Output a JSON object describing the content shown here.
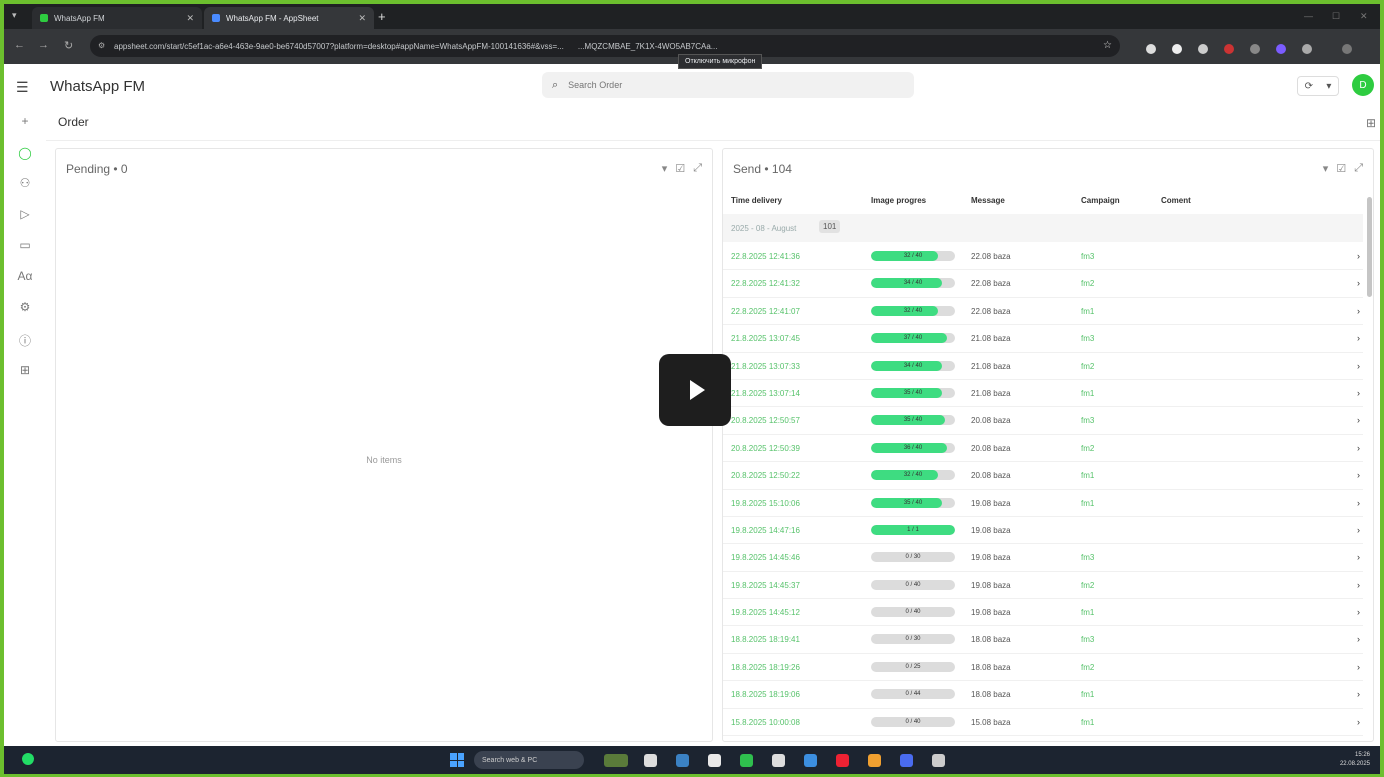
{
  "browser": {
    "tabs": [
      {
        "label": "WhatsApp FM",
        "active": false
      },
      {
        "label": "WhatsApp FM - AppSheet",
        "active": true
      }
    ],
    "url": "appsheet.com/start/c5ef1ac-a6e4-463e-9ae0-be6740d57007?platform=desktop#appName=WhatsAppFM-100141636#&vss=...",
    "url_tail": "...MQZCMBAE_7K1X-4WO5AB7CAa...",
    "tooltip": "Отключить микрофон"
  },
  "app": {
    "title": "WhatsApp FM",
    "search_placeholder": "Search Order",
    "avatar_initial": "D",
    "breadcrumb": "Order"
  },
  "pending_panel": {
    "title": "Pending • 0",
    "empty_text": "No items"
  },
  "send_panel": {
    "title": "Send • 104",
    "columns": [
      "Time delivery",
      "Image progres",
      "Message",
      "Campaign",
      "Coment"
    ],
    "group": {
      "label": "2025 - 08 - August",
      "count": "101"
    },
    "rows": [
      {
        "time": "22.8.2025 12:41:36",
        "progress": 0.8,
        "progress_text": "32 / 40",
        "message": "22.08 baza",
        "campaign": "fm3"
      },
      {
        "time": "22.8.2025 12:41:32",
        "progress": 0.85,
        "progress_text": "34 / 40",
        "message": "22.08 baza",
        "campaign": "fm2"
      },
      {
        "time": "22.8.2025 12:41:07",
        "progress": 0.8,
        "progress_text": "32 / 40",
        "message": "22.08 baza",
        "campaign": "fm1"
      },
      {
        "time": "21.8.2025 13:07:45",
        "progress": 0.9,
        "progress_text": "37 / 40",
        "message": "21.08 baza",
        "campaign": "fm3"
      },
      {
        "time": "21.8.2025 13:07:33",
        "progress": 0.85,
        "progress_text": "34 / 40",
        "message": "21.08 baza",
        "campaign": "fm2"
      },
      {
        "time": "21.8.2025 13:07:14",
        "progress": 0.85,
        "progress_text": "35 / 40",
        "message": "21.08 baza",
        "campaign": "fm1"
      },
      {
        "time": "20.8.2025 12:50:57",
        "progress": 0.88,
        "progress_text": "35 / 40",
        "message": "20.08 baza",
        "campaign": "fm3"
      },
      {
        "time": "20.8.2025 12:50:39",
        "progress": 0.9,
        "progress_text": "36 / 40",
        "message": "20.08 baza",
        "campaign": "fm2"
      },
      {
        "time": "20.8.2025 12:50:22",
        "progress": 0.8,
        "progress_text": "32 / 40",
        "message": "20.08 baza",
        "campaign": "fm1"
      },
      {
        "time": "19.8.2025 15:10:06",
        "progress": 0.85,
        "progress_text": "35 / 40",
        "message": "19.08 baza",
        "campaign": "fm1"
      },
      {
        "time": "19.8.2025 14:47:16",
        "progress": 1.0,
        "progress_text": "1 / 1",
        "message": "19.08 baza",
        "campaign": ""
      },
      {
        "time": "19.8.2025 14:45:46",
        "progress": 0.0,
        "progress_text": "0 / 30",
        "message": "19.08 baza",
        "campaign": "fm3"
      },
      {
        "time": "19.8.2025 14:45:37",
        "progress": 0.0,
        "progress_text": "0 / 40",
        "message": "19.08 baza",
        "campaign": "fm2"
      },
      {
        "time": "19.8.2025 14:45:12",
        "progress": 0.0,
        "progress_text": "0 / 40",
        "message": "19.08 baza",
        "campaign": "fm1"
      },
      {
        "time": "18.8.2025 18:19:41",
        "progress": 0.0,
        "progress_text": "0 / 30",
        "message": "18.08 baza",
        "campaign": "fm3"
      },
      {
        "time": "18.8.2025 18:19:26",
        "progress": 0.0,
        "progress_text": "0 / 25",
        "message": "18.08 baza",
        "campaign": "fm2"
      },
      {
        "time": "18.8.2025 18:19:06",
        "progress": 0.0,
        "progress_text": "0 / 44",
        "message": "18.08 baza",
        "campaign": "fm1"
      },
      {
        "time": "15.8.2025 10:00:08",
        "progress": 0.0,
        "progress_text": "0 / 40",
        "message": "15.08 baza",
        "campaign": "fm1"
      }
    ]
  },
  "taskbar": {
    "search_placeholder": "Search web & PC",
    "time": "15:26",
    "date": "22.08.2025"
  },
  "colors": {
    "accent": "#2ecc40",
    "progress_fill": "#3edc81",
    "time_text": "#56c26a",
    "desktop_border": "#6cbf2e"
  }
}
